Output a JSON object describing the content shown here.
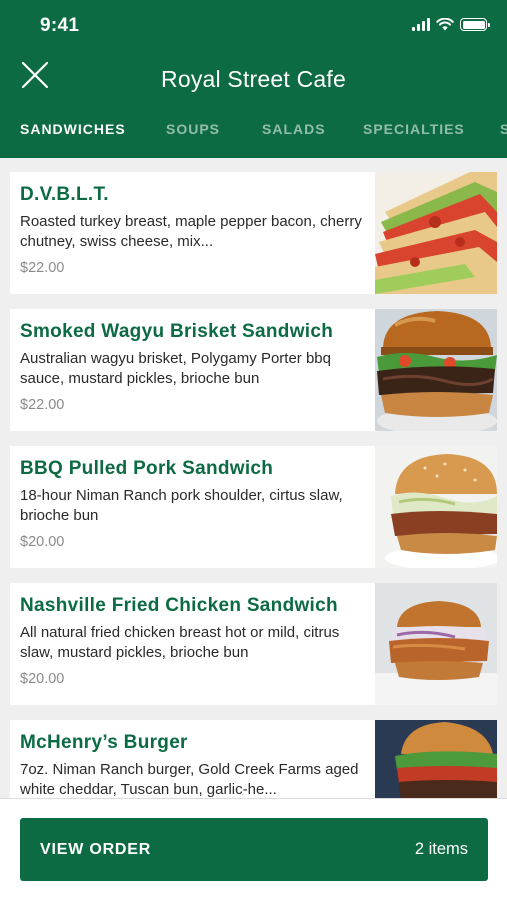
{
  "status_bar": {
    "time": "9:41"
  },
  "header": {
    "title": "Royal Street Cafe",
    "close_icon": "close-icon",
    "accent_color": "#0c6b43"
  },
  "tabs": [
    {
      "label": "SANDWICHES",
      "active": true
    },
    {
      "label": "SOUPS",
      "active": false
    },
    {
      "label": "SALADS",
      "active": false
    },
    {
      "label": "SPECIALTIES",
      "active": false
    },
    {
      "label": "S",
      "active": false
    }
  ],
  "menu_items": [
    {
      "name": "D.V.B.L.T.",
      "description": "Roasted turkey breast, maple pepper bacon, cherry chutney, swiss cheese, mix...",
      "price": "$22.00",
      "image": "blt-sandwich-photo"
    },
    {
      "name": "Smoked Wagyu Brisket Sandwich",
      "description": "Australian wagyu brisket, Polygamy Porter bbq sauce, mustard pickles, brioche bun",
      "price": "$22.00",
      "image": "brisket-sandwich-photo"
    },
    {
      "name": "BBQ Pulled Pork Sandwich",
      "description": "18-hour Niman Ranch pork shoulder, cirtus slaw, brioche bun",
      "price": "$20.00",
      "image": "pulled-pork-sandwich-photo"
    },
    {
      "name": "Nashville Fried Chicken Sandwich",
      "description": "All natural fried chicken breast hot or mild, citrus slaw, mustard pickles, brioche bun",
      "price": "$20.00",
      "image": "fried-chicken-sandwich-photo"
    },
    {
      "name": "McHenry’s Burger",
      "description": "7oz. Niman Ranch burger, Gold Creek Farms aged white cheddar, Tuscan bun, garlic-he...",
      "price": "",
      "image": "burger-photo"
    }
  ],
  "footer": {
    "button_label": "VIEW ORDER",
    "item_count": "2 items"
  }
}
